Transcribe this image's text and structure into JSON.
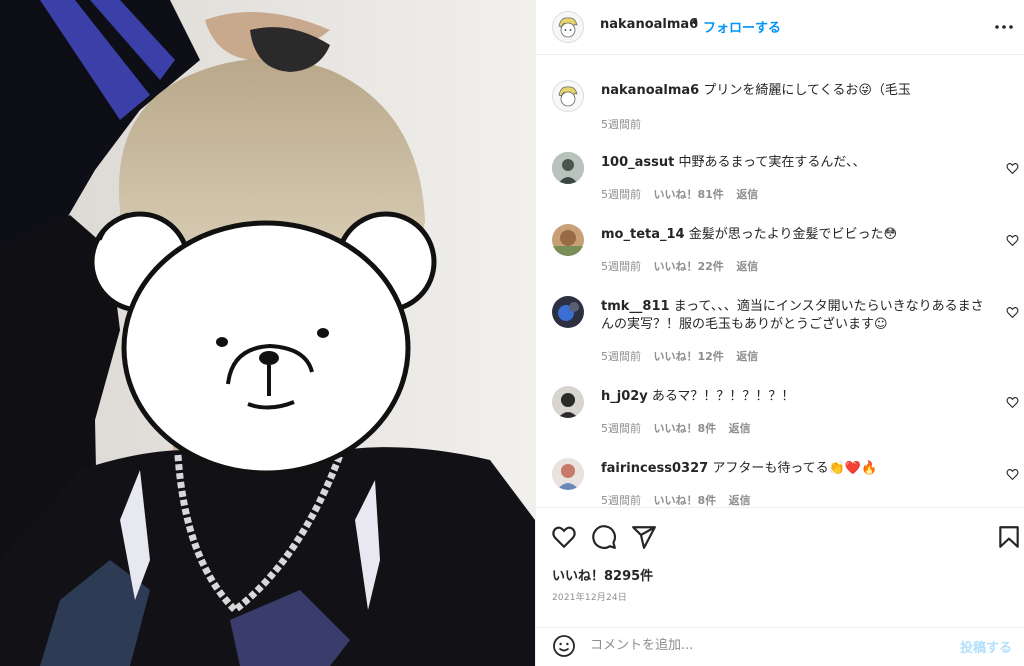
{
  "post": {
    "username": "nakanoalma6",
    "separator": "•",
    "follow_label": "フォローする",
    "more_icon": "more-horizontal-icon"
  },
  "caption": {
    "username": "nakanoalma6",
    "text": "プリンを綺麗にしてくるお😜（毛玉",
    "time": "5週間前"
  },
  "comments": [
    {
      "username": "100_assut",
      "text": "中野あるまって実在するんだ、、",
      "time": "5週間前",
      "likes": "いいね！81件",
      "reply": "返信"
    },
    {
      "username": "mo_teta_14",
      "text": "金髪が思ったより金髪でビビった😳",
      "time": "5週間前",
      "likes": "いいね！22件",
      "reply": "返信"
    },
    {
      "username": "tmk__811",
      "text": "まって、、、適当にインスタ開いたらいきなりあるまさんの実写？！服の毛玉もありがとうございます☺",
      "time": "5週間前",
      "likes": "いいね！12件",
      "reply": "返信"
    },
    {
      "username": "h_j02y",
      "text": "あるマ？！？！？！？！",
      "time": "5週間前",
      "likes": "いいね！8件",
      "reply": "返信"
    },
    {
      "username": "fairincess0327",
      "text": "アフターも待ってる👏❤️🔥",
      "time": "5週間前",
      "likes": "いいね！8件",
      "reply": "返信"
    }
  ],
  "actions": {
    "icons": [
      "heart-icon",
      "comment-icon",
      "share-icon",
      "bookmark-icon"
    ],
    "likes_count": "いいね！8295件",
    "date": "2021年12月24日"
  },
  "comment_input": {
    "placeholder": "コメントを追加...",
    "post_label": "投稿する"
  },
  "colors": {
    "accent": "#0095f6",
    "muted": "#8e8e8e",
    "post_disabled": "#b2dffc"
  }
}
